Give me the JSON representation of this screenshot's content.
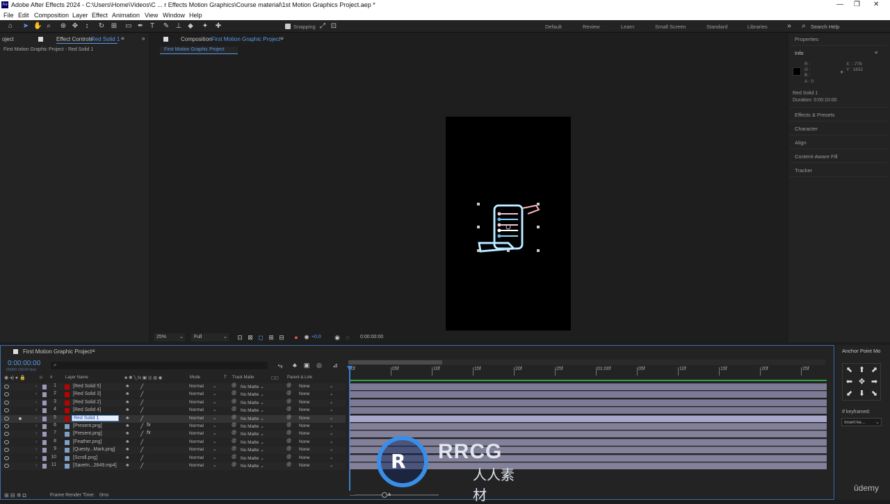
{
  "window": {
    "title": "Adobe After Effects 2024 - C:\\Users\\Home\\Videos\\C ... r Effects Motion Graphics\\Course material\\1st Motion Graphics Project.aep *"
  },
  "menu": [
    "File",
    "Edit",
    "Composition",
    "Layer",
    "Effect",
    "Animation",
    "View",
    "Window",
    "Help"
  ],
  "toolbar": {
    "snapping_label": "Snapping",
    "workspaces": [
      "Default",
      "Review",
      "Learn",
      "Small Screen",
      "Standard",
      "Libraries"
    ],
    "search_label": "Search Help"
  },
  "left_panel": {
    "project_tab": "oject",
    "effect_controls_label": "Effect Controls",
    "effect_controls_layer": "Red Solid 1",
    "breadcrumb": "First Motion Graphic Project - Red Solid 1"
  },
  "composition": {
    "tab_label": "Composition",
    "tab_name": "First Motion Graphic Project",
    "subtab": "First Motion Graphic Project",
    "zoom": "25%",
    "resolution": "Full",
    "exposure": "+0.0",
    "timecode": "0:00:00:00"
  },
  "right_panel": {
    "properties_label": "Properties",
    "info_label": "Info",
    "r": "R :",
    "g": "G :",
    "b": "B :",
    "a": "A :  0",
    "x": "X : -776",
    "y": "Y : 1832",
    "layer_name": "Red Solid 1",
    "duration": "Duration: 0:00:10:00",
    "sections": [
      "Effects & Presets",
      "Character",
      "Align",
      "Content-Aware Fill",
      "Tracker"
    ]
  },
  "timeline": {
    "tab": "First Motion Graphic Project",
    "current_time": "0:00:00:00",
    "fps": "00000 (30.00 fps)",
    "col_hash": "#",
    "col_layer_name": "Layer Name",
    "col_mode": "Mode",
    "col_t": "T",
    "col_track_matte": "Track Matte",
    "col_parent": "Parent & Link",
    "ruler": [
      "0f",
      "05f",
      "10f",
      "15f",
      "20f",
      "25f",
      "01:00f",
      "05f",
      "10f",
      "15f",
      "20f",
      "25f"
    ],
    "layers": [
      {
        "num": "1",
        "name": "[Red Solid 5]",
        "mode": "Normal",
        "matte": "No Matte",
        "parent": "None",
        "color": "#c00000",
        "fx": false
      },
      {
        "num": "2",
        "name": "[Red Solid 3]",
        "mode": "Normal",
        "matte": "No Matte",
        "parent": "None",
        "color": "#c00000",
        "fx": false
      },
      {
        "num": "3",
        "name": "[Red Solid 2]",
        "mode": "Normal",
        "matte": "No Matte",
        "parent": "None",
        "color": "#c00000",
        "fx": false
      },
      {
        "num": "4",
        "name": "[Red Solid 4]",
        "mode": "Normal",
        "matte": "No Matte",
        "parent": "None",
        "color": "#c00000",
        "fx": false
      },
      {
        "num": "5",
        "name": "Red Solid 1",
        "mode": "Normal",
        "matte": "No Matte",
        "parent": "None",
        "color": "#c00000",
        "fx": false
      },
      {
        "num": "6",
        "name": "[Present.png]",
        "mode": "Normal",
        "matte": "No Matte",
        "parent": "None",
        "color": "#7ea1c8",
        "fx": true
      },
      {
        "num": "7",
        "name": "[Present.png]",
        "mode": "Normal",
        "matte": "No Matte",
        "parent": "None",
        "color": "#7ea1c8",
        "fx": true
      },
      {
        "num": "8",
        "name": "[Feather.png]",
        "mode": "Normal",
        "matte": "No Matte",
        "parent": "None",
        "color": "#7ea1c8",
        "fx": false
      },
      {
        "num": "9",
        "name": "[Questy...Mark.png]",
        "mode": "Normal",
        "matte": "No Matte",
        "parent": "None",
        "color": "#7ea1c8",
        "fx": false
      },
      {
        "num": "10",
        "name": "[Scroll.png]",
        "mode": "Normal",
        "matte": "No Matte",
        "parent": "None",
        "color": "#7ea1c8",
        "fx": false
      },
      {
        "num": "11",
        "name": "[SaveIn...2649.mp4]",
        "mode": "Normal",
        "matte": "No Matte",
        "parent": "None",
        "color": "#7ea1c8",
        "fx": false
      }
    ],
    "frame_render_label": "Frame Render Time:",
    "frame_render_value": "0ms"
  },
  "anchor_panel": {
    "title": "Anchor Point Mo",
    "if_keyframed": "If keyframed:",
    "insert_option": "Insert ke..."
  },
  "watermark": {
    "brand": "RRCG",
    "sub": "人人素材"
  },
  "udemy": "ûdemy"
}
